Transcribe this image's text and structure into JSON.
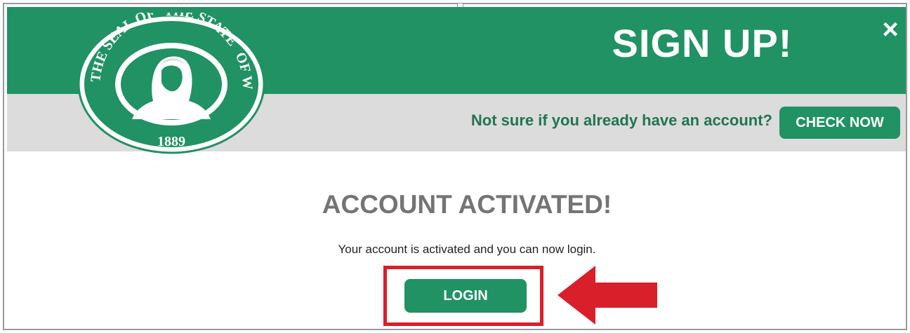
{
  "app": {
    "title": "SIGN UP!",
    "close_label": "×"
  },
  "banner": {
    "question": "Not sure if you already have an account?",
    "check_button": "CHECK NOW"
  },
  "seal": {
    "top_text": "THE STATE",
    "right_text": "OF WASHINGTON",
    "left_text": "THE SEAL OF",
    "year": "1889",
    "icon": "seal-of-washington"
  },
  "content": {
    "heading": "ACCOUNT ACTIVATED!",
    "message": "Your account is activated and you can now login.",
    "login_button": "LOGIN"
  },
  "colors": {
    "primary": "#209263",
    "banner": "#dcdcdc",
    "highlight": "#d91f2a"
  }
}
